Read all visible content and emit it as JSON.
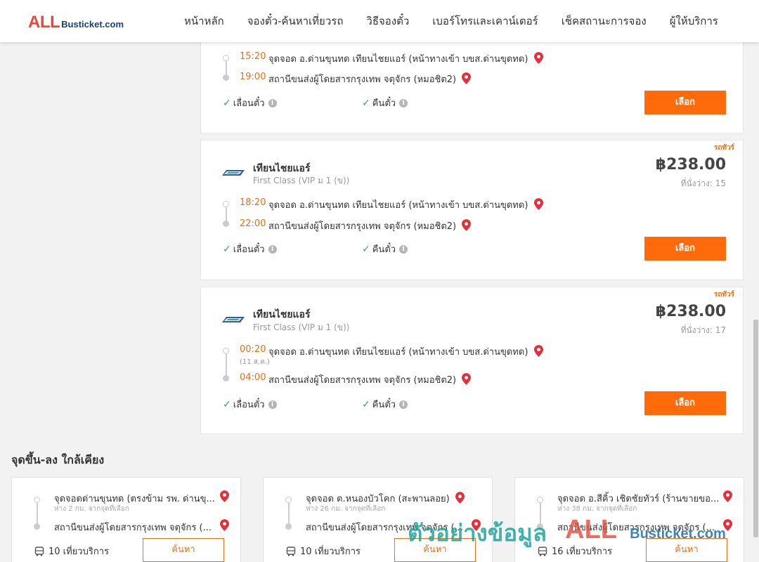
{
  "brand": {
    "logo_main": "ALL",
    "logo_sub": "Busticket.com"
  },
  "nav": [
    "หน้าหลัก",
    "จองตั๋ว-ค้นหาเที่ยวรถ",
    "วิธีจองตั๋ว",
    "เบอร์โทรและเคาน์เตอร์",
    "เช็คสถานะการจอง",
    "ผู้ให้บริการ"
  ],
  "cards": [
    {
      "depart_time": "15:20",
      "depart_stop": "จุดจอด อ.ด่านขุนทด เทียนไชยแอร์ (หน้าทางเข้า บขส.ด่านขุดทด)",
      "arrive_time": "19:00",
      "arrive_stop": "สถานีขนส่งผู้โดยสารกรุงเทพ จตุจักร (หมอชิต2)",
      "feature_1": "เลื่อนตั๋ว",
      "feature_2": "คืนตั๋ว",
      "button": "เลือก"
    },
    {
      "tag": "รถทัวร์",
      "operator": "เทียนไชยแอร์",
      "class": "First Class (VIP ม 1 (ข))",
      "price": "฿238.00",
      "seats": "ที่นั่งว่าง: 15",
      "depart_time": "18:20",
      "depart_stop": "จุดจอด อ.ด่านขุนทด เทียนไชยแอร์ (หน้าทางเข้า บขส.ด่านขุดทด)",
      "arrive_time": "22:00",
      "arrive_stop": "สถานีขนส่งผู้โดยสารกรุงเทพ จตุจักร (หมอชิต2)",
      "feature_1": "เลื่อนตั๋ว",
      "feature_2": "คืนตั๋ว",
      "button": "เลือก"
    },
    {
      "tag": "รถทัวร์",
      "operator": "เทียนไชยแอร์",
      "class": "First Class (VIP ม 1 (ข))",
      "price": "฿238.00",
      "seats": "ที่นั่งว่าง: 17",
      "depart_time": "00:20",
      "depart_date": "(11 ส.ค.)",
      "depart_stop": "จุดจอด อ.ด่านขุนทด เทียนไชยแอร์ (หน้าทางเข้า บขส.ด่านขุดทด)",
      "arrive_time": "04:00",
      "arrive_stop": "สถานีขนส่งผู้โดยสารกรุงเทพ จตุจักร (หมอชิต2)",
      "feature_1": "เลื่อนตั๋ว",
      "feature_2": "คืนตั๋ว",
      "button": "เลือก"
    }
  ],
  "nearby": {
    "title": "จุดขึ้น-ลง ใกล้เคียง",
    "items": [
      {
        "from": "จุดจอดด่านขุนทด (ตรงข้าม รพ. ด่านขุ...",
        "distance": "ห่าง 2 กม. จากจุดที่เลือก",
        "to": "สถานีขนส่งผู้โดยสารกรุงเทพ จตุจักร (...",
        "trips": "10 เที่ยวบริการ",
        "button": "ค้นหา"
      },
      {
        "from": "จุดจอด ต.หนองบัวโคก (สะพานลอย)",
        "distance": "ห่าง 26 กม. จากจุดที่เลือก",
        "to": "สถานีขนส่งผู้โดยสารกรุงเทพ จตุจักร (...",
        "trips": "10 เที่ยวบริการ",
        "button": "ค้นหา"
      },
      {
        "from": "จุดจอด อ.สีคิ้ว เชิดชัยทัวร์ (ร้านขายขอ...",
        "distance": "ห่าง 38 กม. จากจุดที่เลือก",
        "to": "สถานีขนส่งผู้โดยสารกรุงเทพ จตุจักร (...",
        "trips": "16 เที่ยวบริการ",
        "button": "ค้นหา"
      }
    ]
  },
  "watermark": {
    "text": "ตัวอย่างข้อมูล",
    "logo_main": "ALL",
    "logo_sub": "Busticket.com"
  },
  "colors": {
    "accent": "#ff6b0a",
    "time": "#f26b10",
    "check": "#3aa843",
    "pin": "#e4303e",
    "watermark": "#19a096"
  },
  "icons": [
    "map-pin-icon",
    "check-icon",
    "info-icon",
    "bus-icon",
    "operator-logo"
  ]
}
